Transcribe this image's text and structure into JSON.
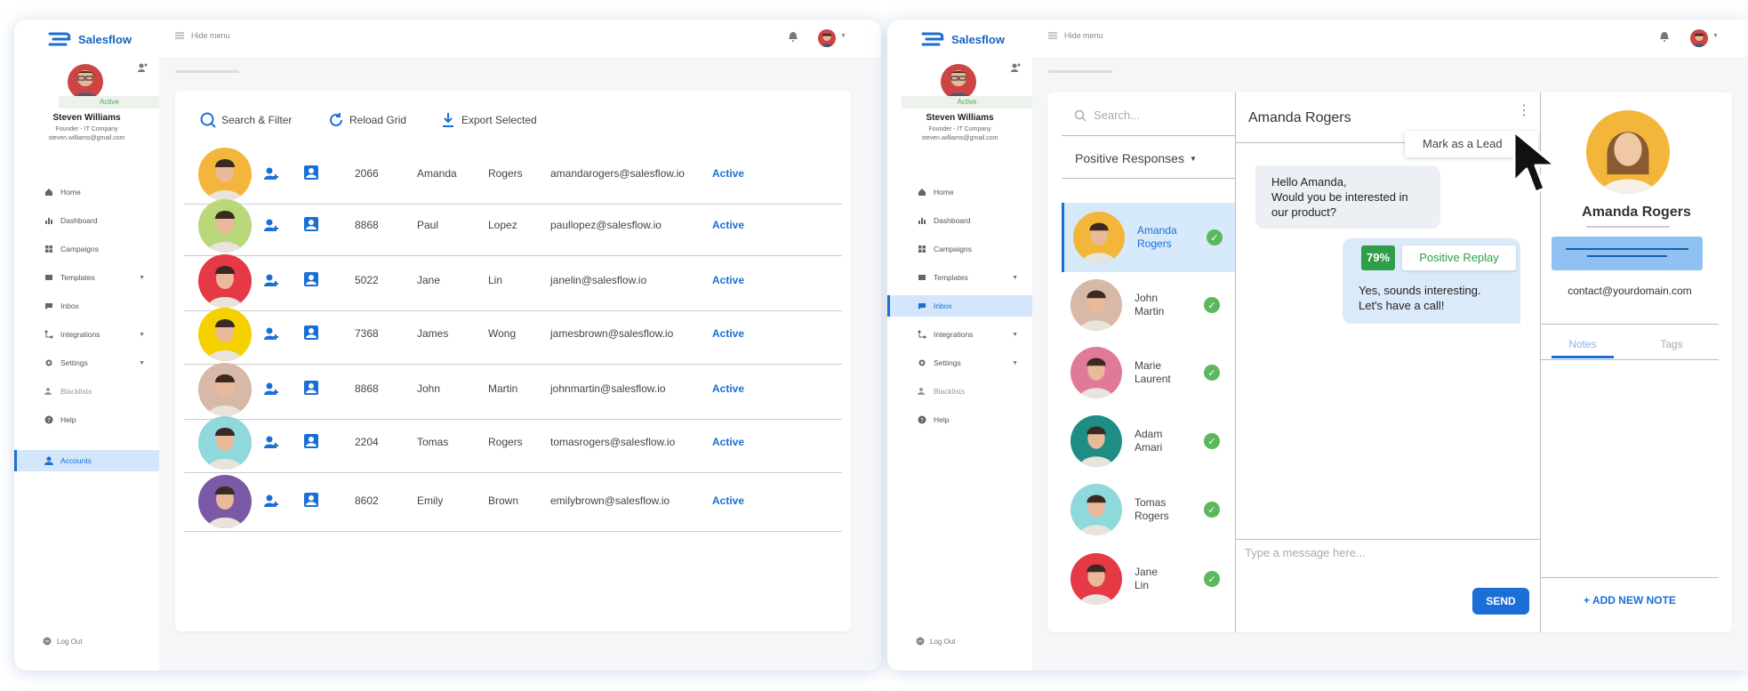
{
  "brand": {
    "name": "Salesflow",
    "accent": "#1a6fd6"
  },
  "user": {
    "status": "Active",
    "name": "Steven Williams",
    "role": "Founder - IT Company",
    "email": "steven.williams@gmail.com"
  },
  "topbar": {
    "hide_menu": "Hide menu"
  },
  "left_nav": [
    {
      "label": "Home",
      "icon": "home-icon"
    },
    {
      "label": "Dashboard",
      "icon": "chart-icon"
    },
    {
      "label": "Campaigns",
      "icon": "grid-icon"
    },
    {
      "label": "Templates",
      "icon": "template-icon",
      "expandable": true
    },
    {
      "label": "Inbox",
      "icon": "inbox-icon"
    },
    {
      "label": "Integrations",
      "icon": "integration-icon",
      "expandable": true
    },
    {
      "label": "Settings",
      "icon": "gear-icon",
      "expandable": true
    },
    {
      "label": "Blacklists",
      "icon": "blacklist-icon"
    },
    {
      "label": "Help",
      "icon": "help-icon"
    }
  ],
  "accounts_nav": {
    "label": "Accounts"
  },
  "logout": "Log Out",
  "toolbar": {
    "search": "Search & Filter",
    "reload": "Reload Grid",
    "export": "Export Selected"
  },
  "accounts": [
    {
      "id": "2066",
      "first": "Amanda",
      "last": "Rogers",
      "email": "amandarogers@salesflow.io",
      "status": "Active",
      "bg": "#f4b63a"
    },
    {
      "id": "8868",
      "first": "Paul",
      "last": "Lopez",
      "email": "paullopez@salesflow.io",
      "status": "Active",
      "bg": "#b8d87a"
    },
    {
      "id": "5022",
      "first": "Jane",
      "last": "Lin",
      "email": "janelin@salesflow.io",
      "status": "Active",
      "bg": "#e53945"
    },
    {
      "id": "7368",
      "first": "James",
      "last": "Wong",
      "email": "jamesbrown@salesflow.io",
      "status": "Active",
      "bg": "#f5d100"
    },
    {
      "id": "8868",
      "first": "John",
      "last": "Martin",
      "email": "johnmartin@salesflow.io",
      "status": "Active",
      "bg": "#d8b8a6"
    },
    {
      "id": "2204",
      "first": "Tomas",
      "last": "Rogers",
      "email": "tomasrogers@salesflow.io",
      "status": "Active",
      "bg": "#8fd8dc"
    },
    {
      "id": "8602",
      "first": "Emily",
      "last": "Brown",
      "email": "emilybrown@salesflow.io",
      "status": "Active",
      "bg": "#7a5aa6"
    }
  ],
  "inbox": {
    "search_placeholder": "Search...",
    "filter": "Positive Responses",
    "contacts": [
      {
        "first": "Amanda",
        "last": "Rogers",
        "bg": "#f4b63a"
      },
      {
        "first": "John",
        "last": "Martin",
        "bg": "#d8b8a6"
      },
      {
        "first": "Marie",
        "last": "Laurent",
        "bg": "#e17a98"
      },
      {
        "first": "Adam",
        "last": "Amari",
        "bg": "#1e8e84"
      },
      {
        "first": "Tomas",
        "last": "Rogers",
        "bg": "#8fd8dc"
      },
      {
        "first": "Jane",
        "last": "Lin",
        "bg": "#e53945"
      }
    ],
    "chat_title": "Amanda Rogers",
    "mark_lead": "Mark as a Lead",
    "msg_in": [
      "Hello Amanda,",
      "Would you be interested in",
      "our product?"
    ],
    "score": "79%",
    "tag": "Positive Replay",
    "msg_out": [
      "Yes, sounds interesting.",
      "Let's have a call!"
    ],
    "message_placeholder": "Type a message here...",
    "send": "SEND",
    "profile_name": "Amanda Rogers",
    "profile_email": "contact@yourdomain.com",
    "tabs": [
      "Notes",
      "Tags"
    ],
    "add_note": "+ ADD NEW NOTE"
  }
}
